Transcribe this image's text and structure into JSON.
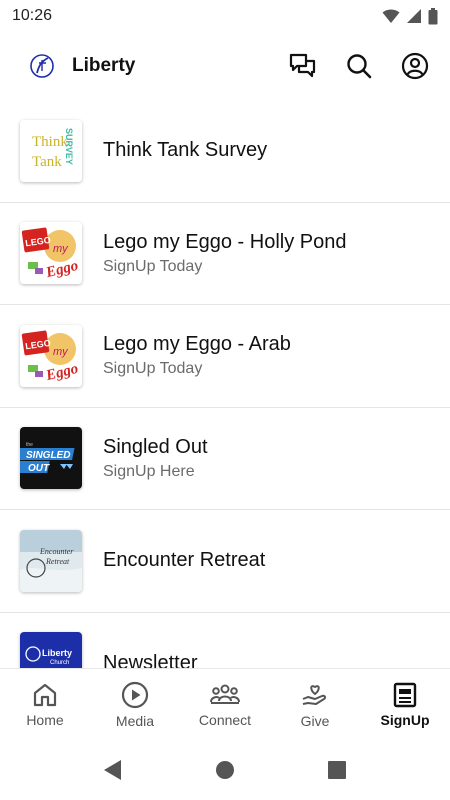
{
  "status_bar": {
    "time": "10:26"
  },
  "app_bar": {
    "title": "Liberty"
  },
  "list": [
    {
      "title": "Think Tank Survey",
      "subtitle": ""
    },
    {
      "title": "Lego my Eggo - Holly Pond",
      "subtitle": "SignUp Today"
    },
    {
      "title": "Lego my Eggo - Arab",
      "subtitle": "SignUp Today"
    },
    {
      "title": "Singled Out",
      "subtitle": "SignUp Here"
    },
    {
      "title": "Encounter Retreat",
      "subtitle": ""
    },
    {
      "title": "Newsletter",
      "subtitle": ""
    }
  ],
  "thumbs": {
    "think_tank": {
      "line1": "Think",
      "line2": "Tank",
      "side": "SURVEY"
    },
    "lego_holly": {
      "brand": "LEGO",
      "word1": "my",
      "word2": "Eggo"
    },
    "lego_arab": {
      "brand": "LEGO",
      "word1": "my",
      "word2": "Eggo"
    },
    "singled": {
      "small": "the",
      "line1": "SINGLED",
      "line2": "OUT"
    },
    "encounter": {
      "line1": "Encounter",
      "line2": "Retreat"
    },
    "newsletter": {
      "brand": "Liberty",
      "sub": "Church"
    }
  },
  "bottom_nav": [
    {
      "label": "Home",
      "icon": "home-icon"
    },
    {
      "label": "Media",
      "icon": "play-circle-icon"
    },
    {
      "label": "Connect",
      "icon": "group-icon"
    },
    {
      "label": "Give",
      "icon": "hand-heart-icon"
    },
    {
      "label": "SignUp",
      "icon": "signup-form-icon",
      "active": true
    }
  ],
  "colors": {
    "accent": "#111111",
    "inactive": "#555555",
    "divider": "#e4e4e4",
    "logo_blue": "#1d2fa8"
  }
}
